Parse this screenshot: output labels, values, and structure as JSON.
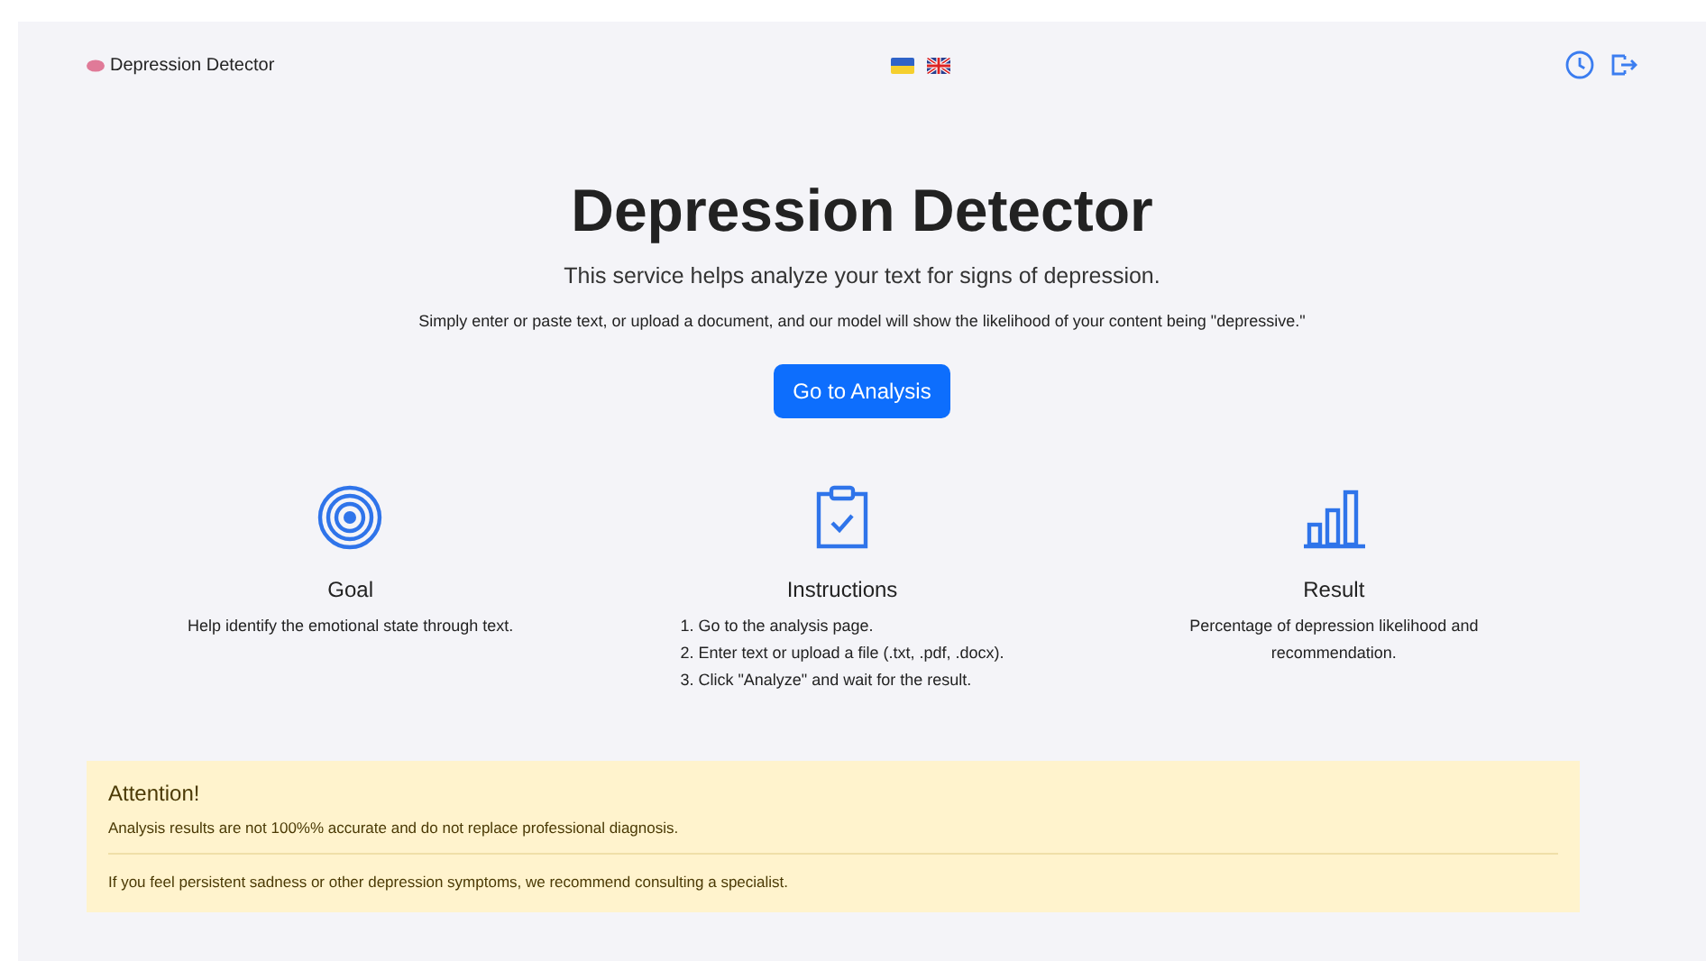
{
  "header": {
    "brand": "Depression Detector",
    "languages": [
      {
        "kind": "ukrainian"
      },
      {
        "kind": "english"
      }
    ]
  },
  "hero": {
    "title": "Depression Detector",
    "subtitle": "This service helps analyze your text for signs of depression.",
    "description": "Simply enter or paste text, or upload a document, and our model will show the likelihood of your content being \"depressive.\"",
    "button": "Go to Analysis"
  },
  "features": [
    {
      "kind": "goal",
      "title": "Goal",
      "lines": [
        "Help identify the emotional state through text."
      ]
    },
    {
      "kind": "instructions",
      "title": "Instructions",
      "lines": [
        "1. Go to the analysis page.",
        "2. Enter text or upload a file (.txt, .pdf, .docx).",
        "3. Click \"Analyze\" and wait for the result."
      ]
    },
    {
      "kind": "result",
      "title": "Result",
      "lines": [
        "Percentage of depression likelihood and recommendation."
      ]
    }
  ],
  "alert": {
    "title": "Attention!",
    "messages": [
      "Analysis results are not 100%% accurate and do not replace professional diagnosis.",
      "If you feel persistent sadness or other depression symptoms, we recommend consulting a specialist."
    ]
  }
}
